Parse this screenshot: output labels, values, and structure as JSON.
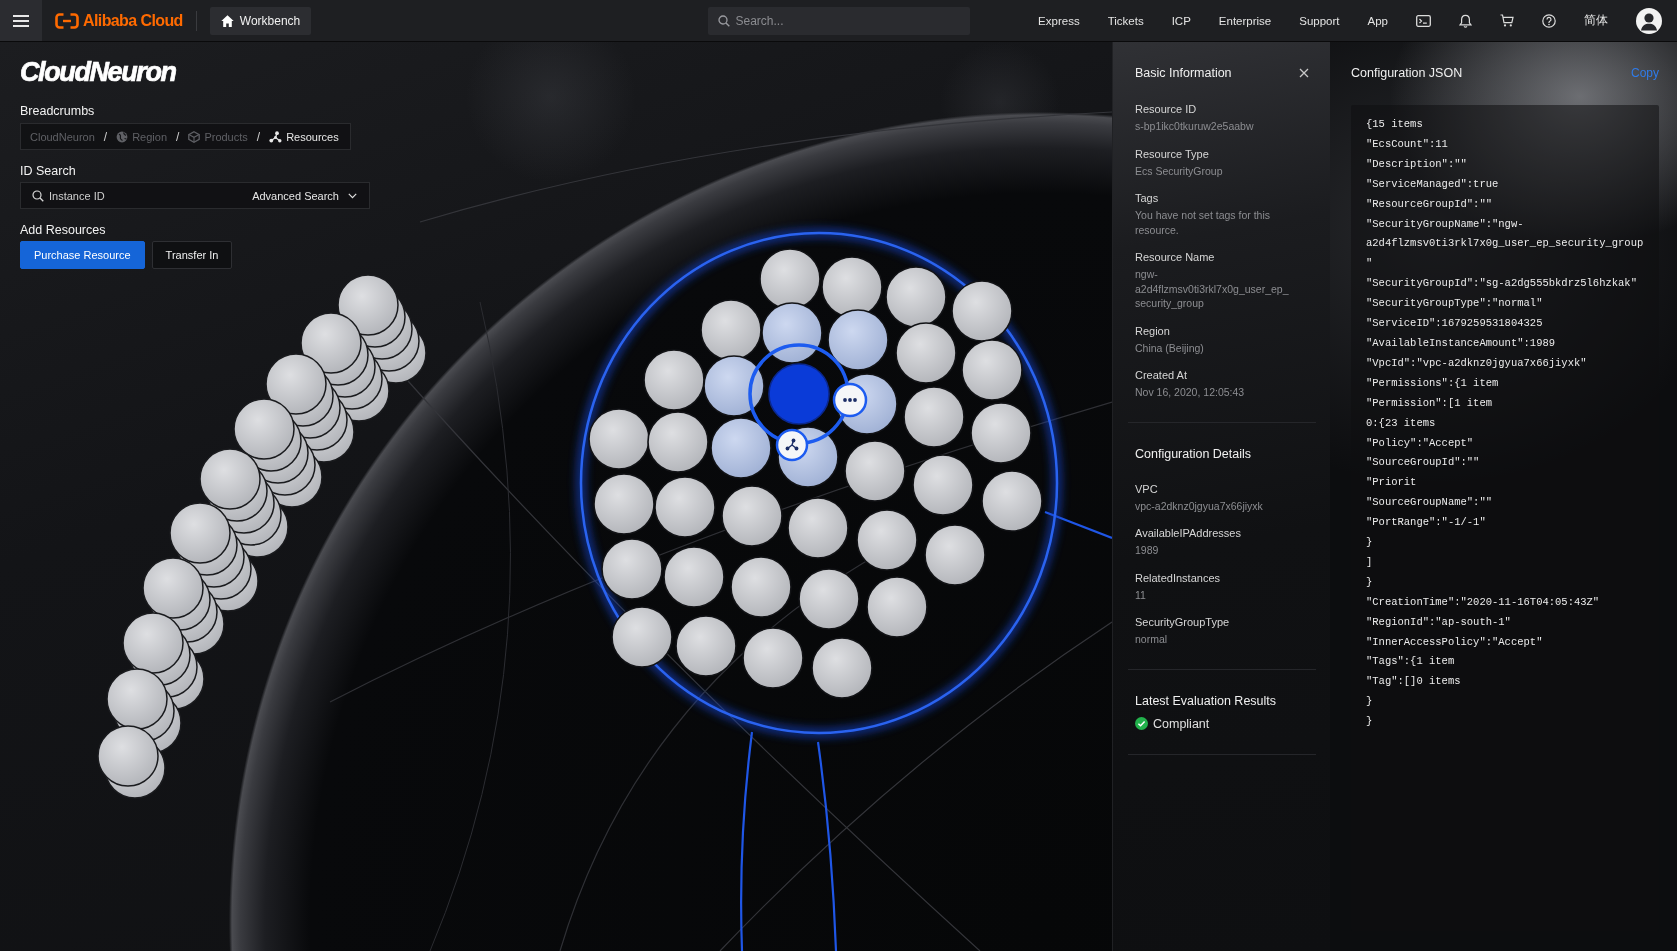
{
  "top_bar": {
    "brand": "Alibaba Cloud",
    "workbench": "Workbench",
    "search": {
      "placeholder": "Search..."
    },
    "links": [
      "Express",
      "Tickets",
      "ICP",
      "Enterprise",
      "Support",
      "App"
    ],
    "language": "简体"
  },
  "header": {
    "title": "CloudNeuron"
  },
  "breadcrumbs": {
    "label": "Breadcrumbs",
    "items": [
      {
        "kind": "root",
        "text": "CloudNeuron",
        "current": false
      },
      {
        "kind": "region",
        "separator": "/",
        "text": "Region",
        "current": false
      },
      {
        "kind": "products",
        "separator": "/",
        "text": "Products",
        "current": false
      },
      {
        "kind": "resources",
        "separator": "/",
        "text": "Resources",
        "current": true
      }
    ]
  },
  "id_search": {
    "label": "ID Search",
    "placeholder": "Instance ID",
    "advanced": "Advanced Search"
  },
  "add_resources": {
    "label": "Add Resources",
    "buttons": [
      {
        "kind": "primary",
        "text": "Purchase Resource"
      },
      {
        "kind": "default",
        "text": "Transfer In"
      }
    ]
  },
  "graph": {
    "nodes": [
      {
        "selected": false
      },
      {
        "selected": false
      },
      {
        "selected": false
      },
      {
        "selected": false
      },
      {
        "selected": false
      },
      {
        "selected": false
      },
      {
        "selected": false
      },
      {
        "selected": false
      },
      {
        "selected": false
      },
      {
        "selected": false
      },
      {
        "selected": false
      },
      {
        "selected": true
      },
      {
        "selected": false
      },
      {
        "selected": false
      },
      {
        "selected": false
      },
      {
        "selected": false
      },
      {
        "selected": false
      },
      {
        "selected": false
      },
      {
        "selected": false
      },
      {
        "selected": false
      },
      {
        "selected": false
      },
      {
        "selected": false
      },
      {
        "selected": false
      },
      {
        "selected": false
      },
      {
        "selected": false
      },
      {
        "selected": false
      },
      {
        "selected": false
      },
      {
        "selected": false
      },
      {
        "selected": false
      },
      {
        "selected": false
      },
      {
        "selected": false
      },
      {
        "selected": false
      },
      {
        "selected": false
      },
      {
        "selected": false
      },
      {
        "selected": false
      },
      {
        "selected": false
      },
      {
        "selected": false
      }
    ]
  },
  "basic_info": {
    "title": "Basic Information",
    "fields": [
      {
        "label": "Resource ID",
        "value": "s-bp1ikc0tkuruw2e5aabw"
      },
      {
        "label": "Resource Type",
        "value": "Ecs SecurityGroup"
      },
      {
        "label": "Tags",
        "value": "You have not set tags for this resource."
      },
      {
        "label": "Resource Name",
        "value": "ngw-a2d4flzmsv0ti3rkl7x0g_user_ep_security_group"
      },
      {
        "label": "Region",
        "value": "China (Beijing)"
      },
      {
        "label": "Created At",
        "value": "Nov 16, 2020, 12:05:43"
      }
    ]
  },
  "config_details": {
    "title": "Configuration Details",
    "fields": [
      {
        "label": "VPC",
        "value": "vpc-a2dknz0jgyua7x66jiyxk"
      },
      {
        "label": "AvailableIPAddresses",
        "value": "1989"
      },
      {
        "label": "RelatedInstances",
        "value": "11"
      },
      {
        "label": "SecurityGroupType",
        "value": "normal"
      }
    ]
  },
  "evaluation": {
    "title": "Latest Evaluation Results",
    "status": "Compliant",
    "compliant": true
  },
  "config_json": {
    "title": "Configuration JSON",
    "copy": "Copy",
    "lines": [
      "{15 items",
      "\"EcsCount\":11",
      "\"Description\":\"\"",
      "\"ServiceManaged\":true",
      "\"ResourceGroupId\":\"\"",
      "\"SecurityGroupName\":\"ngw-",
      "a2d4flzmsv0ti3rkl7x0g_user_ep_security_group",
      "\"",
      "\"SecurityGroupId\":\"sg-a2dg555bkdrz5l6hzkak\"",
      "\"SecurityGroupType\":\"normal\"",
      "\"ServiceID\":1679259531804325",
      "\"AvailableInstanceAmount\":1989",
      "\"VpcId\":\"vpc-a2dknz0jgyua7x66jiyxk\"",
      "\"Permissions\":{1 item",
      "\"Permission\":[1 item",
      "0:{23 items",
      "\"Policy\":\"Accept\"",
      "\"SourceGroupId\":\"\"",
      "\"Priorit",
      "\"SourceGroupName\":\"\"",
      "\"PortRange\":\"-1/-1\"",
      "}",
      "]",
      "}",
      "\"CreationTime\":\"2020-11-16T04:05:43Z\"",
      "\"RegionId\":\"ap-south-1\"",
      "\"InnerAccessPolicy\":\"Accept\"",
      "\"Tags\":{1 item",
      "\"Tag\":[]0 items",
      "}",
      "}"
    ]
  }
}
